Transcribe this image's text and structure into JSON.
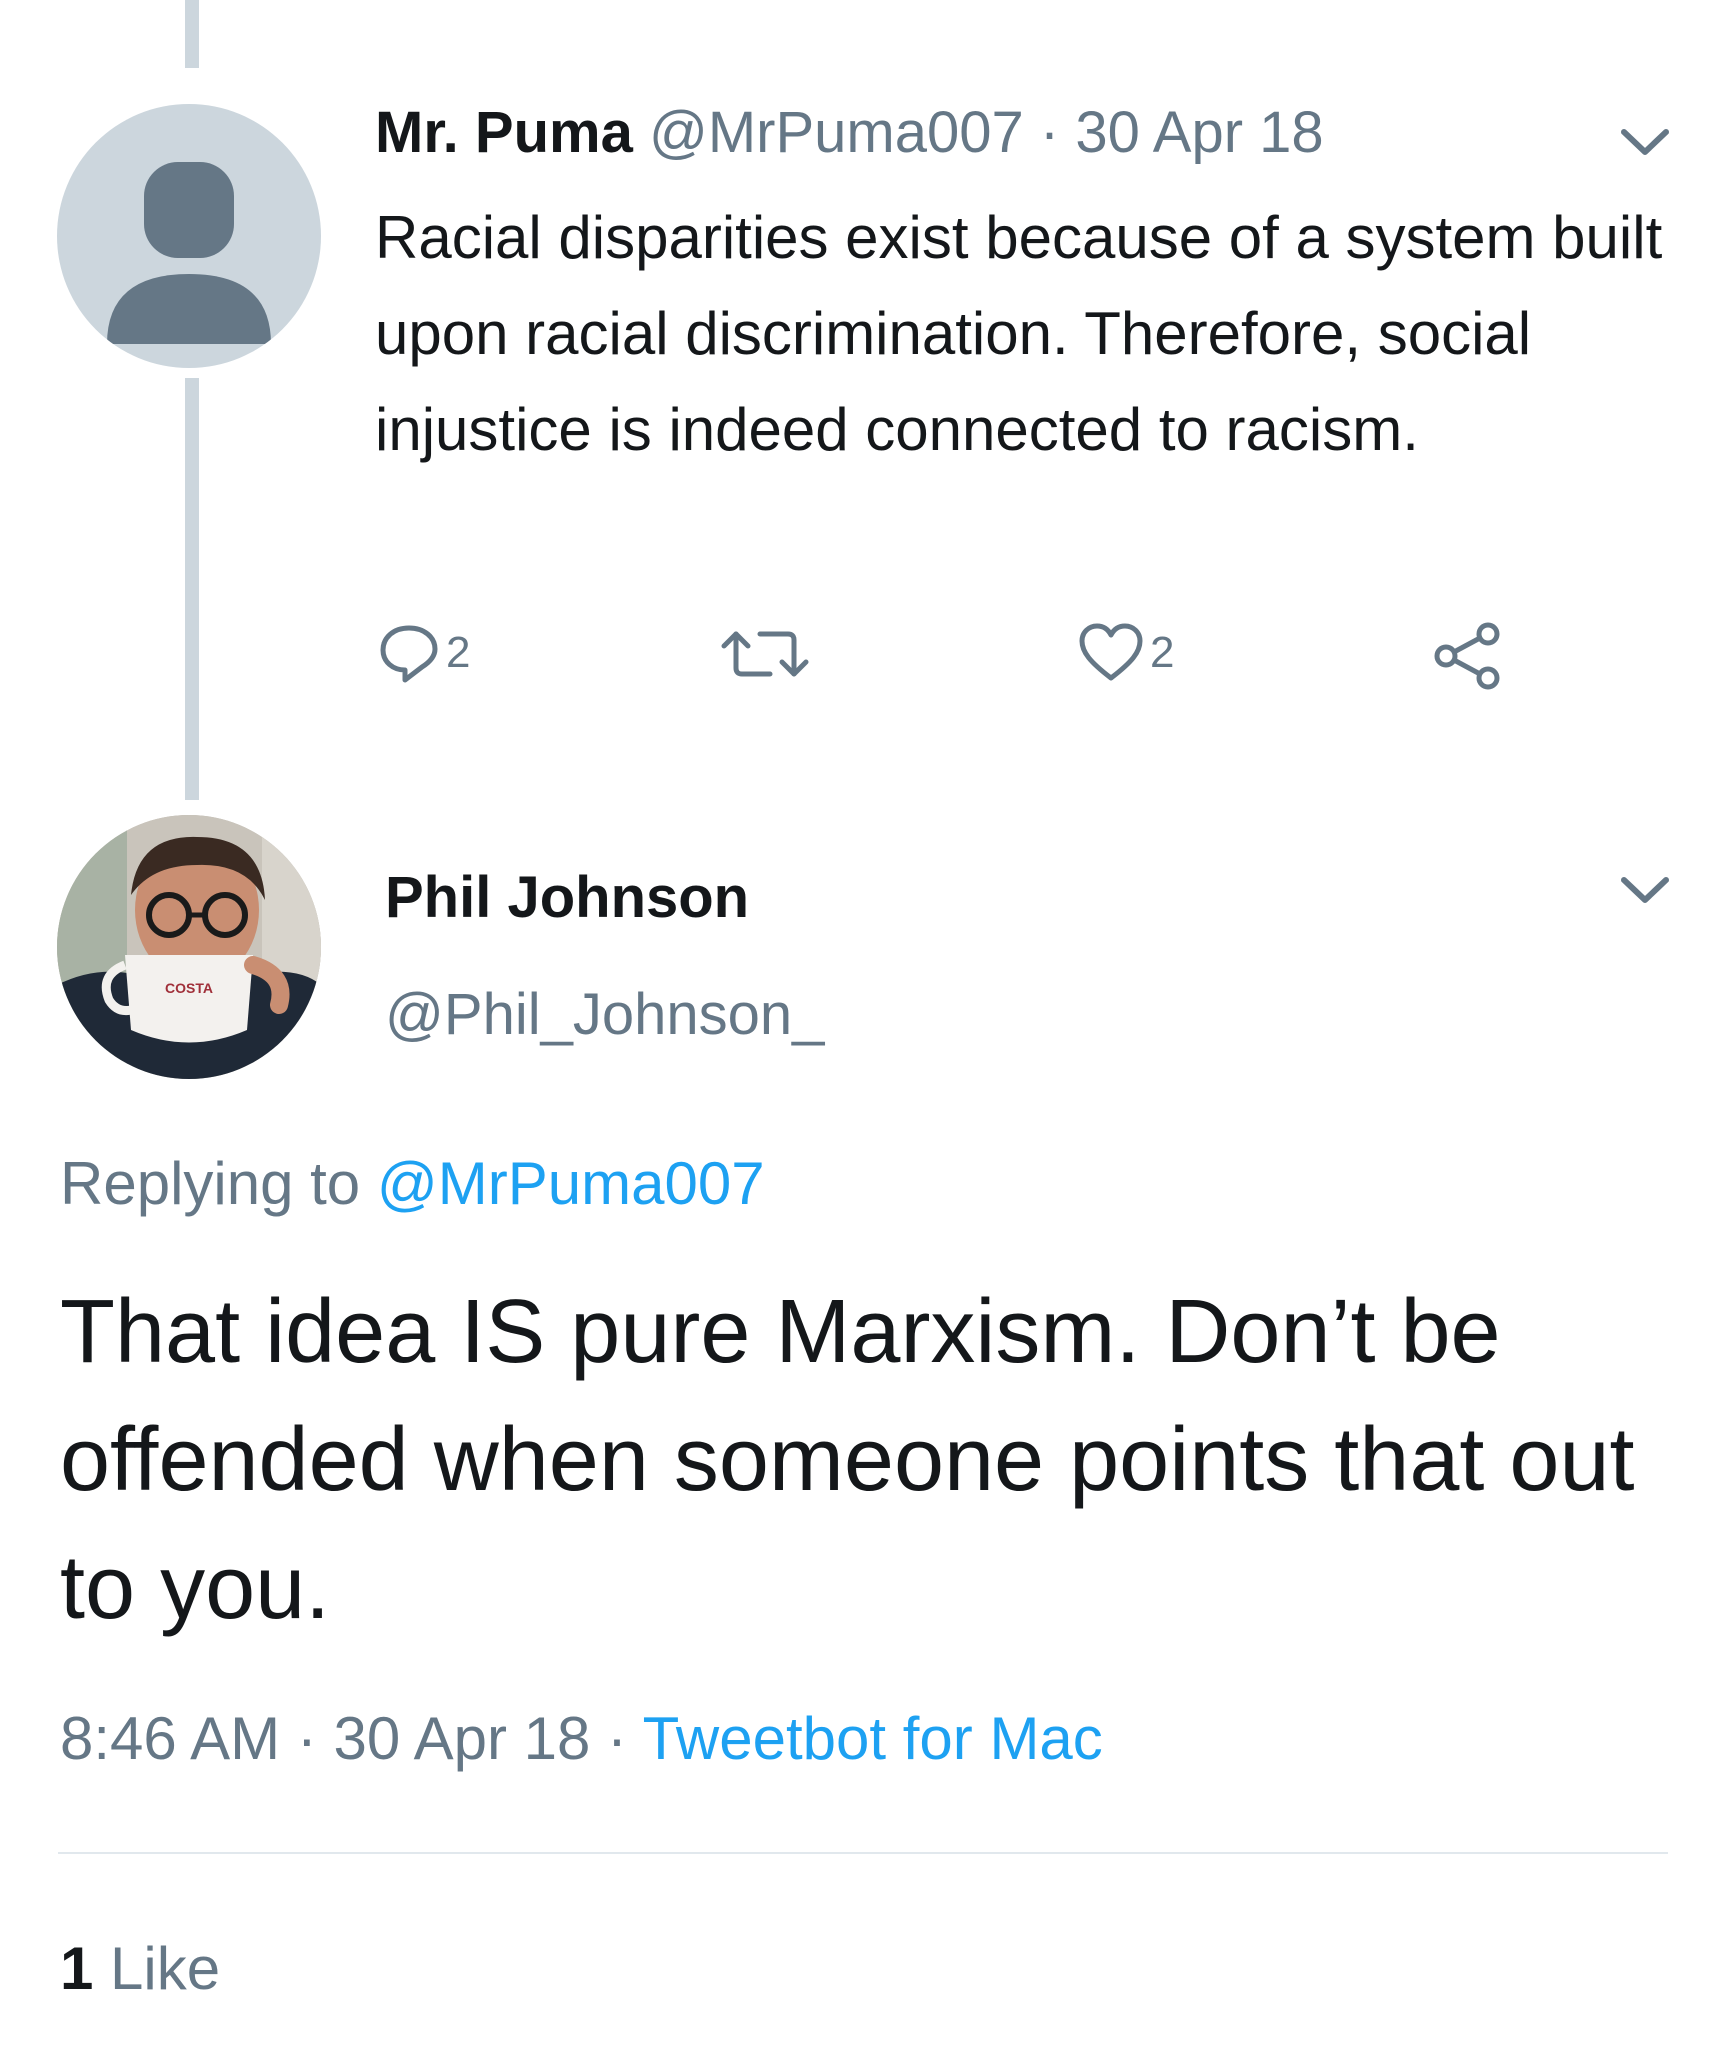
{
  "colors": {
    "text": "#14171a",
    "muted": "#657786",
    "link": "#1da1f2",
    "line": "#ccd6dd",
    "avatar_bg": "#ccd6dd",
    "avatar_fg": "#657786"
  },
  "parent_tweet": {
    "name": "Mr. Puma",
    "handle": "@MrPuma007",
    "separator": "·",
    "date": "30 Apr 18",
    "text": "Racial disparities exist because of a system built upon racial discrimination. Therefore, social injustice is indeed connected to racism.",
    "actions": {
      "reply_count": "2",
      "retweet_count": "",
      "like_count": "2"
    },
    "icons": [
      "default-avatar-icon",
      "chevron-down-icon",
      "reply-icon",
      "retweet-icon",
      "heart-icon",
      "share-icon"
    ]
  },
  "main_tweet": {
    "name": "Phil Johnson",
    "handle": "@Phil_Johnson_",
    "replying_prefix": "Replying to",
    "replying_handle": "@MrPuma007",
    "text": "That idea IS pure Marxism. Don’t be offended when someone points that out to you.",
    "time": "8:46 AM",
    "date": "30 Apr 18",
    "separator": "·",
    "client": "Tweetbot for Mac",
    "likes_count": "1",
    "likes_label": "Like",
    "avatar_mug_text": "COSTA"
  }
}
